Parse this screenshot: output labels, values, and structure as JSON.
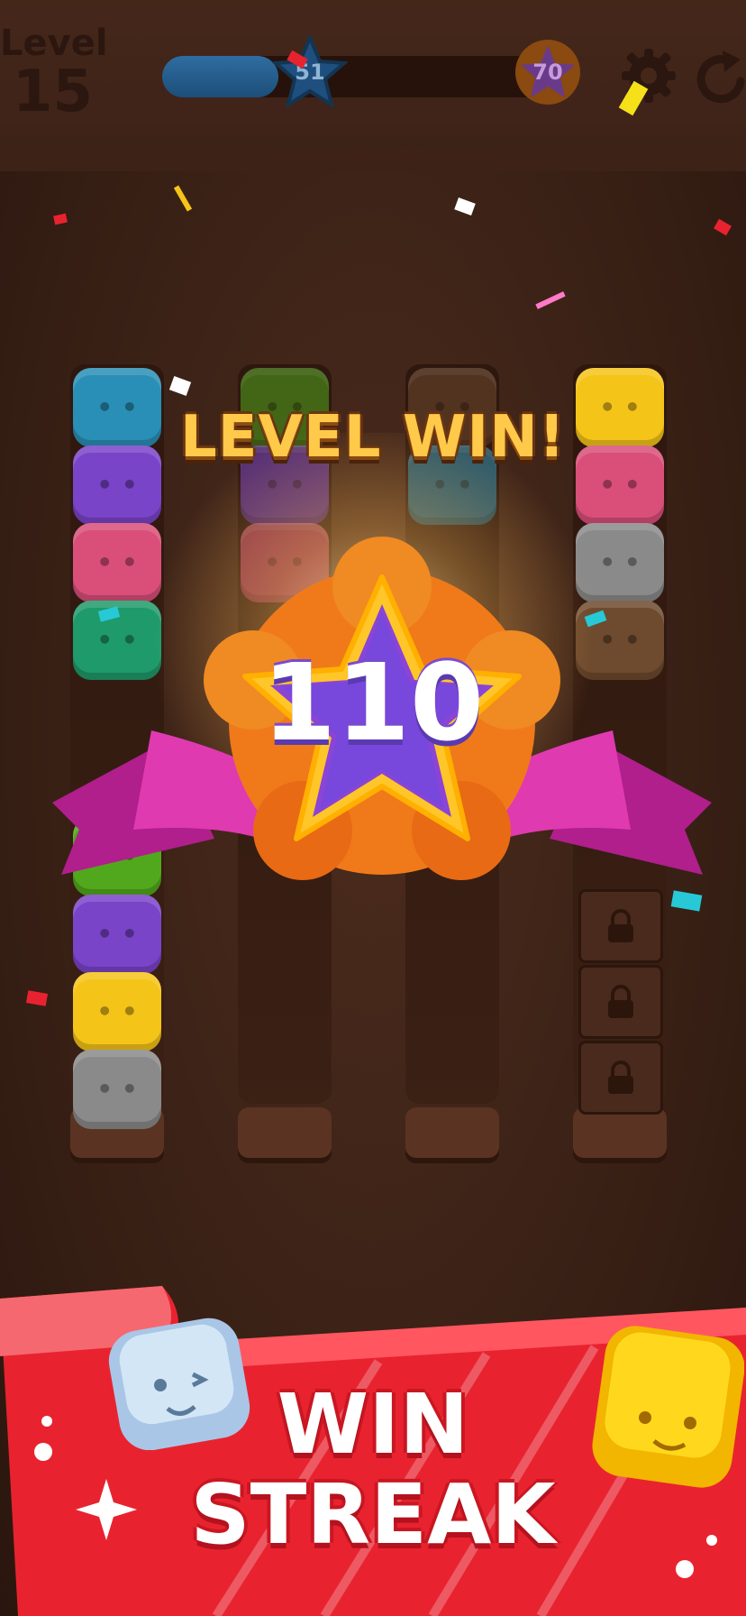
{
  "header": {
    "level_label": "Level",
    "level_number": "15",
    "progress_fraction": 0.3,
    "current_star_value": "51",
    "target_star_value": "70",
    "settings_icon": "gear-icon",
    "restart_icon": "restart-icon"
  },
  "overlay": {
    "title": "LEVEL WIN!",
    "score": "110"
  },
  "banner": {
    "line1": "WIN",
    "line2": "STREAK"
  },
  "colors": {
    "blue": "#2a8fb6",
    "purple": "#7a44c9",
    "pink": "#d94f7a",
    "green": "#1f9a6a",
    "lime": "#52a81c",
    "yellow": "#f5c419",
    "gray": "#8a8a8a",
    "brown": "#6e4a2e",
    "ribbon": "#e03ab0",
    "banner_red": "#e8232f"
  },
  "tubes": [
    {
      "blocks": [
        "blue",
        "purple",
        "pink",
        "green"
      ],
      "lower_blocks": [
        "lime",
        "purple",
        "yellow",
        "gray"
      ]
    },
    {
      "blocks": [
        "lime",
        "purple",
        "pink"
      ],
      "lower_blocks": []
    },
    {
      "blocks": [
        "brown",
        "blue"
      ],
      "lower_blocks": []
    },
    {
      "blocks": [
        "yellow",
        "pink",
        "gray",
        "brown"
      ],
      "locked_slots": 3
    }
  ]
}
